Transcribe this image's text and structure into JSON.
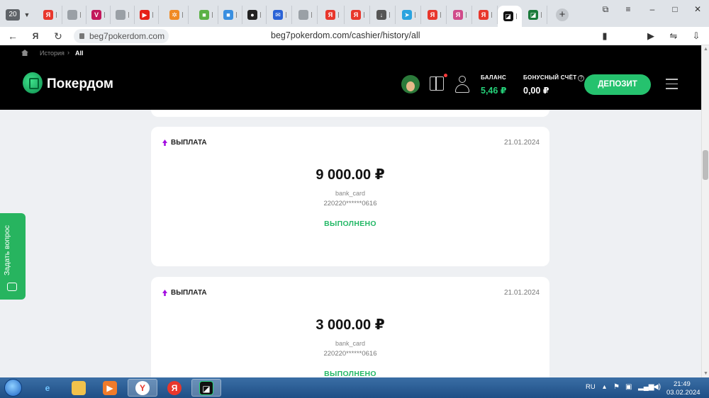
{
  "browser": {
    "tab_count": "20",
    "tabs": [
      {
        "icon": "yandex-icon",
        "color": "#e8372c",
        "glyph": "Я"
      },
      {
        "icon": "document-icon",
        "color": "#9aa0a6",
        "glyph": ""
      },
      {
        "icon": "vk-icon",
        "color": "#c2185b",
        "glyph": "V"
      },
      {
        "icon": "document-icon",
        "color": "#9aa0a6",
        "glyph": ""
      },
      {
        "icon": "youtube-icon",
        "color": "#e62117",
        "glyph": "▶"
      },
      {
        "icon": "gear-icon",
        "color": "#f08a24",
        "glyph": "✲"
      },
      {
        "icon": "microsoft-icon",
        "color": "#5bb146",
        "glyph": "■"
      },
      {
        "icon": "microsoft-icon",
        "color": "#3a8fe0",
        "glyph": "■"
      },
      {
        "icon": "circle-icon",
        "color": "#222222",
        "glyph": "●"
      },
      {
        "icon": "mail-icon",
        "color": "#2a62d6",
        "glyph": "✉"
      },
      {
        "icon": "document-icon",
        "color": "#9aa0a6",
        "glyph": ""
      },
      {
        "icon": "yandex-icon",
        "color": "#e8372c",
        "glyph": "Я"
      },
      {
        "icon": "yandex-icon",
        "color": "#e8372c",
        "glyph": "Я"
      },
      {
        "icon": "download-icon",
        "color": "#555555",
        "glyph": "↓"
      },
      {
        "icon": "telegram-icon",
        "color": "#2aa3df",
        "glyph": "➤"
      },
      {
        "icon": "yandex-icon",
        "color": "#e8372c",
        "glyph": "Я"
      },
      {
        "icon": "yandex-icon",
        "color": "#d04a8a",
        "glyph": "Я"
      },
      {
        "icon": "yandex-icon",
        "color": "#e8372c",
        "glyph": "Я"
      },
      {
        "icon": "pokerdom-icon",
        "color": "#111111",
        "glyph": "◪",
        "active": true
      },
      {
        "icon": "pokerdom-icon",
        "color": "#1a7a3a",
        "glyph": "◪"
      }
    ],
    "url_short": "beg7pokerdom.com",
    "url_full": "beg7pokerdom.com/cashier/history/all"
  },
  "site": {
    "breadcrumb": {
      "item1": "История",
      "sep": "›",
      "item2": "All"
    },
    "logo_text": "Покердом",
    "balance_label": "БАЛАНС",
    "balance_value": "5,46 ₽",
    "bonus_label": "БОНУСНЫЙ СЧЁТ",
    "bonus_value": "0,00 ₽",
    "deposit_label": "ДЕПОЗИТ"
  },
  "transactions": [
    {
      "type": "ВЫПЛАТА",
      "date": "21.01.2024",
      "amount": "9 000.00 ₽",
      "method": "bank_card",
      "card": "220220******0616",
      "status": "ВЫПОЛНЕНО"
    },
    {
      "type": "ВЫПЛАТА",
      "date": "21.01.2024",
      "amount": "3 000.00 ₽",
      "method": "bank_card",
      "card": "220220******0616",
      "status": "ВЫПОЛНЕНО"
    }
  ],
  "help_label": "Задать вопрос",
  "taskbar": {
    "lang": "RU",
    "time": "21:49",
    "date": "03.02.2024"
  },
  "colors": {
    "accent_green": "#25c26e",
    "payout_arrow": "#a30ee0",
    "header_bg": "#000000"
  }
}
